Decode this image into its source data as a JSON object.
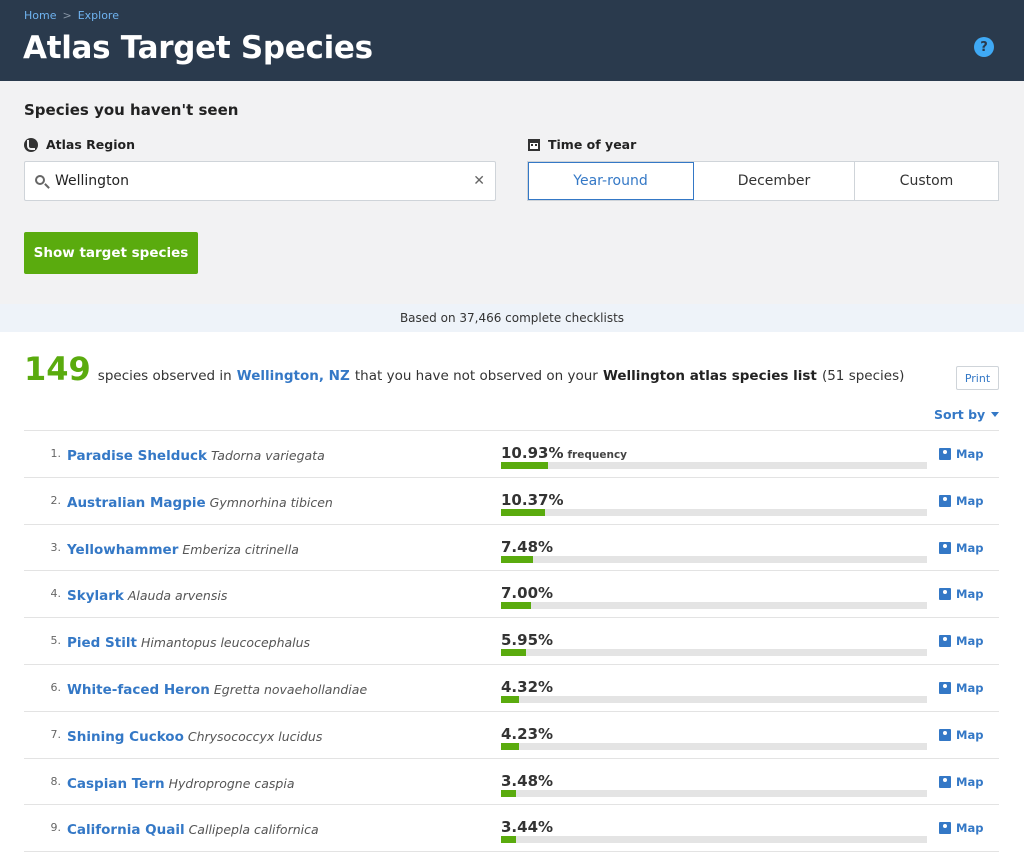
{
  "breadcrumb": {
    "home": "Home",
    "separator": ">",
    "explore": "Explore"
  },
  "header": {
    "title": "Atlas Target Species",
    "help_icon": "?"
  },
  "filters": {
    "heading": "Species you haven't seen",
    "region_label": "Atlas Region",
    "region_value": "Wellington",
    "clear_icon": "✕",
    "time_label": "Time of year",
    "time_options": [
      "Year-round",
      "December",
      "Custom"
    ],
    "time_selected": "Year-round",
    "show_button": "Show target species"
  },
  "based_on": "Based on 37,466 complete checklists",
  "summary": {
    "count": "149",
    "text1": "species observed in",
    "place": "Wellington, NZ",
    "text2": "that you have not observed on your",
    "list_name": "Wellington atlas species list",
    "text3": "(51 species)"
  },
  "print_label": "Print",
  "sort_label": "Sort by",
  "frequency_label": "frequency",
  "map_label": "Map",
  "colors": {
    "header_bg": "#2a3a4d",
    "accent_green": "#5aab0e",
    "link_blue": "#3478c6"
  },
  "species": [
    {
      "rank": "1.",
      "common": "Paradise Shelduck",
      "scientific": "Tadorna variegata",
      "frequency": "10.93%",
      "value": 10.93
    },
    {
      "rank": "2.",
      "common": "Australian Magpie",
      "scientific": "Gymnorhina tibicen",
      "frequency": "10.37%",
      "value": 10.37
    },
    {
      "rank": "3.",
      "common": "Yellowhammer",
      "scientific": "Emberiza citrinella",
      "frequency": "7.48%",
      "value": 7.48
    },
    {
      "rank": "4.",
      "common": "Skylark",
      "scientific": "Alauda arvensis",
      "frequency": "7.00%",
      "value": 7.0
    },
    {
      "rank": "5.",
      "common": "Pied Stilt",
      "scientific": "Himantopus leucocephalus",
      "frequency": "5.95%",
      "value": 5.95
    },
    {
      "rank": "6.",
      "common": "White-faced Heron",
      "scientific": "Egretta novaehollandiae",
      "frequency": "4.32%",
      "value": 4.32
    },
    {
      "rank": "7.",
      "common": "Shining Cuckoo",
      "scientific": "Chrysococcyx lucidus",
      "frequency": "4.23%",
      "value": 4.23
    },
    {
      "rank": "8.",
      "common": "Caspian Tern",
      "scientific": "Hydroprogne caspia",
      "frequency": "3.48%",
      "value": 3.48
    },
    {
      "rank": "9.",
      "common": "California Quail",
      "scientific": "Callipepla californica",
      "frequency": "3.44%",
      "value": 3.44
    }
  ]
}
